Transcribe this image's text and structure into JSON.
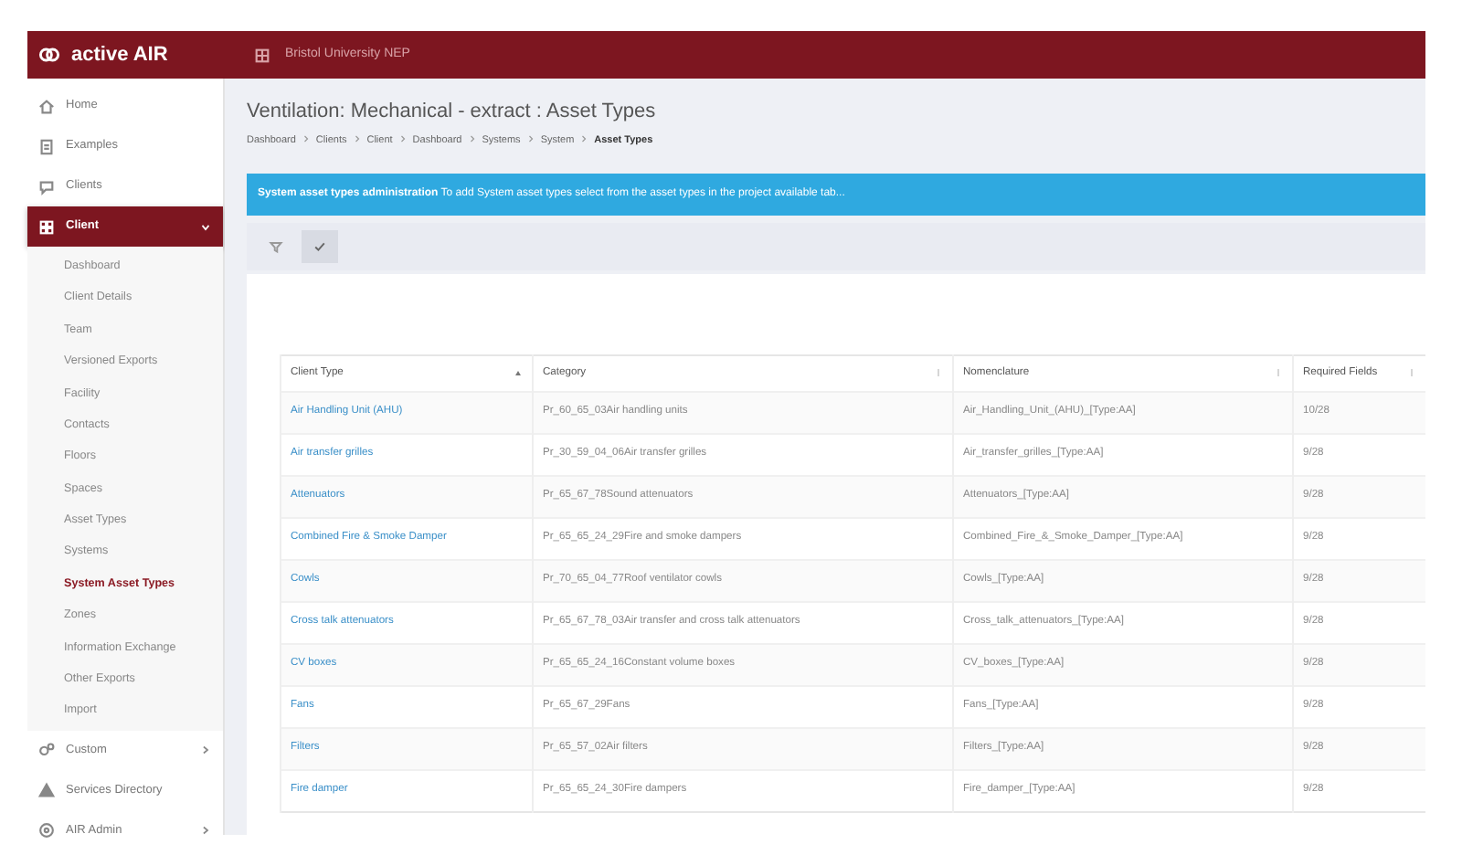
{
  "header": {
    "brand": "active AIR",
    "project": "Bristol University NEP"
  },
  "sidebar": {
    "items": [
      {
        "label": "Home",
        "selected": false
      },
      {
        "label": "Examples",
        "selected": false
      },
      {
        "label": "Clients",
        "selected": false
      },
      {
        "label": "Client",
        "selected": true,
        "expanded": true,
        "children": [
          {
            "label": "Dashboard",
            "selected": false
          },
          {
            "label": "Client Details",
            "selected": false
          },
          {
            "label": "Team",
            "selected": false
          },
          {
            "label": "Versioned Exports",
            "selected": false
          },
          {
            "label": "Facility",
            "selected": false
          },
          {
            "label": "Contacts",
            "selected": false
          },
          {
            "label": "Floors",
            "selected": false
          },
          {
            "label": "Spaces",
            "selected": false
          },
          {
            "label": "Asset Types",
            "selected": false
          },
          {
            "label": "Systems",
            "selected": false
          },
          {
            "label": "System Asset Types",
            "selected": true
          },
          {
            "label": "Zones",
            "selected": false
          },
          {
            "label": "Information Exchange",
            "selected": false
          },
          {
            "label": "Other Exports",
            "selected": false
          },
          {
            "label": "Import",
            "selected": false
          }
        ]
      },
      {
        "label": "Custom",
        "selected": false,
        "expanded": false
      },
      {
        "label": "Services Directory",
        "selected": false
      },
      {
        "label": "AIR Admin",
        "selected": false,
        "expanded": false
      }
    ]
  },
  "page": {
    "title": "Ventilation: Mechanical - extract : Asset Types",
    "breadcrumb": [
      {
        "label": "Dashboard",
        "current": false
      },
      {
        "label": "Clients",
        "current": false
      },
      {
        "label": "Client",
        "current": false
      },
      {
        "label": "Dashboard",
        "current": false
      },
      {
        "label": "Systems",
        "current": false
      },
      {
        "label": "System",
        "current": false
      },
      {
        "label": "Asset Types",
        "current": true
      }
    ]
  },
  "alert": {
    "text": "**System asset types administration** To add System asset types select from the asset types in the project available tab..."
  },
  "tabs": [
    {
      "selected": false
    },
    {
      "selected": true
    }
  ],
  "table": {
    "columns": [
      {
        "label": "Client Type",
        "sorted": true
      },
      {
        "label": "Category",
        "sorted": false
      },
      {
        "label": "Nomenclature",
        "sorted": false
      },
      {
        "label": "Required Fields",
        "sorted": false
      }
    ],
    "rows": [
      [
        "Air Handling Unit (AHU)",
        "Pr_60_65_03Air handling units",
        "Air_Handling_Unit_(AHU)_[Type:AA]",
        "10/28"
      ],
      [
        "Air transfer grilles",
        "Pr_30_59_04_06Air transfer grilles",
        "Air_transfer_grilles_[Type:AA]",
        "9/28"
      ],
      [
        "Attenuators",
        "Pr_65_67_78Sound attenuators",
        "Attenuators_[Type:AA]",
        "9/28"
      ],
      [
        "Combined Fire & Smoke Damper",
        "Pr_65_65_24_29Fire and smoke dampers",
        "Combined_Fire_&_Smoke_Damper_[Type:AA]",
        "9/28"
      ],
      [
        "Cowls",
        "Pr_70_65_04_77Roof ventilator cowls",
        "Cowls_[Type:AA]",
        "9/28"
      ],
      [
        "Cross talk attenuators",
        "Pr_65_67_78_03Air transfer and cross talk attenuators",
        "Cross_talk_attenuators_[Type:AA]",
        "9/28"
      ],
      [
        "CV boxes",
        "Pr_65_65_24_16Constant volume boxes",
        "CV_boxes_[Type:AA]",
        "9/28"
      ],
      [
        "Fans",
        "Pr_65_67_29Fans",
        "Fans_[Type:AA]",
        "9/28"
      ],
      [
        "Filters",
        "Pr_65_57_02Air filters",
        "Filters_[Type:AA]",
        "9/28"
      ],
      [
        "Fire damper",
        "Pr_65_65_24_30Fire dampers",
        "Fire_damper_[Type:AA]",
        "9/28"
      ]
    ]
  }
}
